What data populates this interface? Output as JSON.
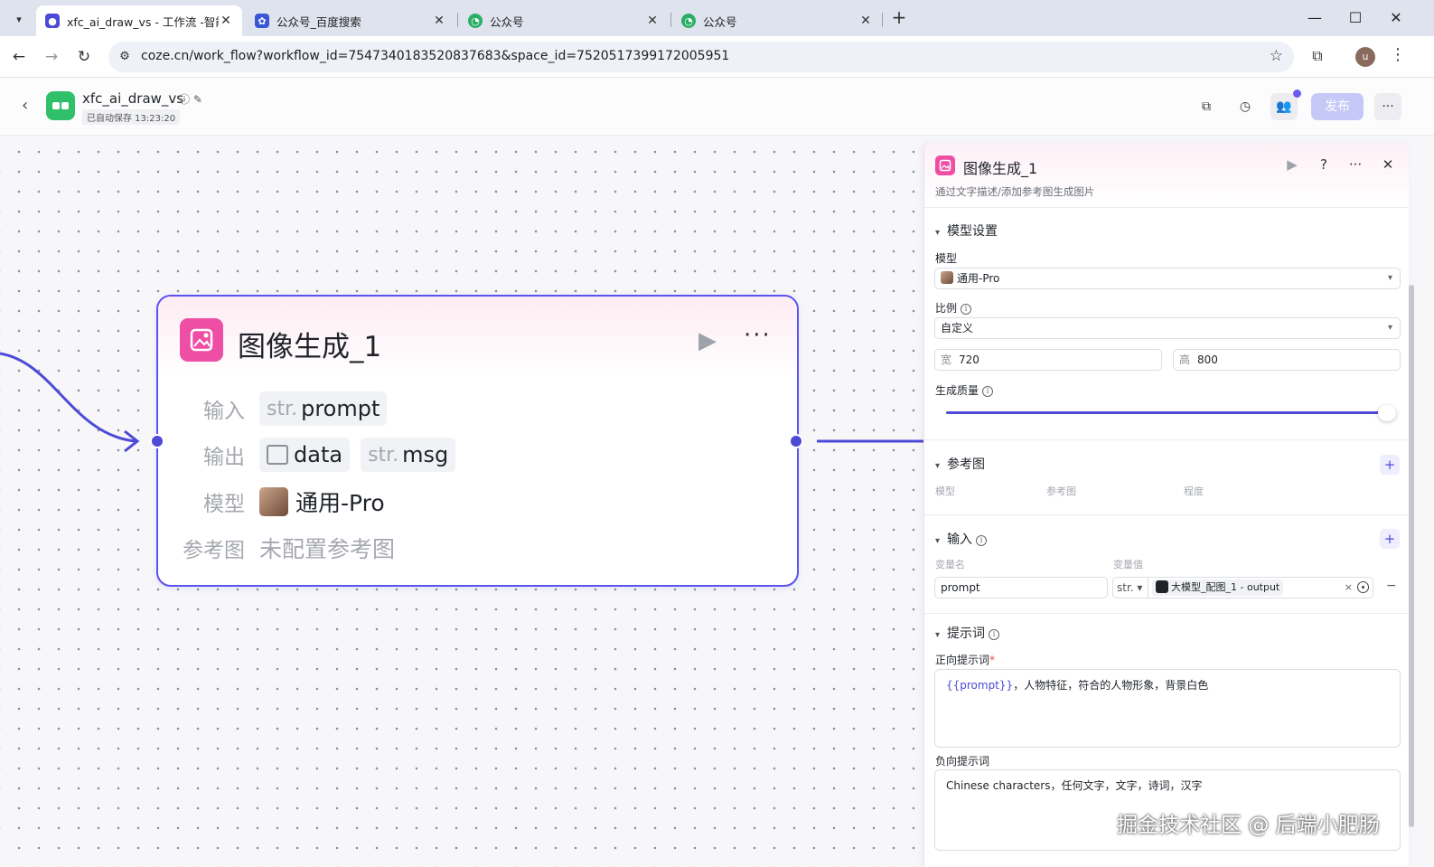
{
  "browser": {
    "tabs": [
      {
        "label": "xfc_ai_draw_vs - 工作流 -智能",
        "active": true,
        "icon": "coze-icon"
      },
      {
        "label": "公众号_百度搜索",
        "active": false,
        "icon": "baidu-paw-icon"
      },
      {
        "label": "公众号",
        "active": false,
        "icon": "wechat-icon"
      },
      {
        "label": "公众号",
        "active": false,
        "icon": "wechat-icon"
      }
    ],
    "url": "coze.cn/work_flow?workflow_id=7547340183520837683&space_id=7520517399172005951",
    "profile_initial": "u"
  },
  "header": {
    "workflow_name": "xfc_ai_draw_vs",
    "autosave": "已自动保存 13:23:20",
    "publish_label": "发布",
    "accent_color": "#4d4ad6",
    "publish_disabled_color": "#c6c9f7"
  },
  "node": {
    "title": "图像生成_1",
    "input_label": "输入",
    "inputs": [
      {
        "type": "str.",
        "name": "prompt"
      }
    ],
    "output_label": "输出",
    "outputs": [
      {
        "type": "image",
        "name": "data"
      },
      {
        "type": "str.",
        "name": "msg"
      }
    ],
    "model_label": "模型",
    "model_value": "通用-Pro",
    "ref_label": "参考图",
    "ref_value": "未配置参考图",
    "icon_color": "#ee4fa5"
  },
  "panel": {
    "title": "图像生成_1",
    "description": "通过文字描述/添加参考图生成图片",
    "model_section": "模型设置",
    "model_label": "模型",
    "model_value": "通用-Pro",
    "ratio_label": "比例",
    "ratio_value": "自定义",
    "width_label": "宽",
    "width_value": "720",
    "height_label": "高",
    "height_value": "800",
    "quality_label": "生成质量",
    "quality_fraction": 1.0,
    "ref_section": "参考图",
    "ref_cols": [
      "模型",
      "参考图",
      "程度"
    ],
    "input_section": "输入",
    "input_cols": [
      "变量名",
      "变量值"
    ],
    "input_row": {
      "name": "prompt",
      "type": "str.",
      "ref": "大模型_配图_1 - output"
    },
    "prompt_section": "提示词",
    "positive_label": "正向提示词",
    "positive_var": "{{prompt}}",
    "positive_text": "，人物特征，符合的人物形象，背景白色",
    "negative_label": "负向提示词",
    "negative_text": "Chinese characters，任何文字，文字，诗词，汉字"
  },
  "watermark": "掘金技术社区 @ 后端小肥肠"
}
